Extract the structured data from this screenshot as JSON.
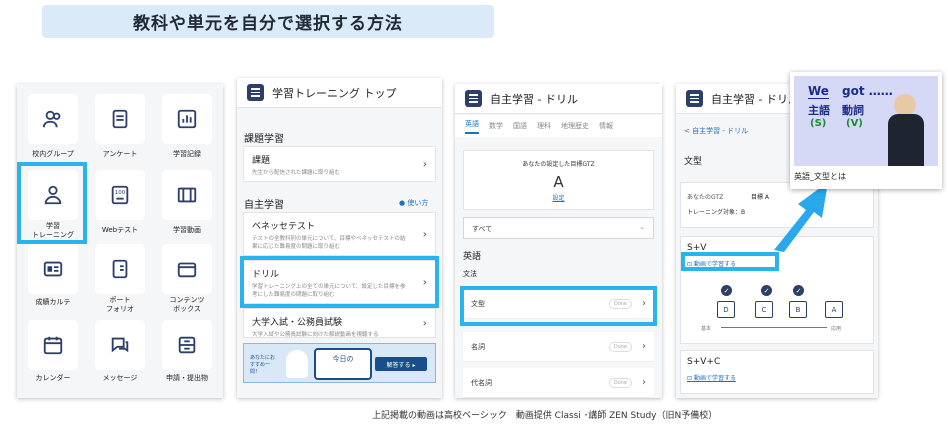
{
  "banner": {
    "title": "教科や単元を自分で選択する方法"
  },
  "menu": {
    "items": [
      {
        "label": "校内グループ"
      },
      {
        "label": "アンケート"
      },
      {
        "label": "学習記録"
      },
      {
        "label": "学習\nトレーニング"
      },
      {
        "label": "Webテスト"
      },
      {
        "label": "学習動画"
      },
      {
        "label": "成績カルテ"
      },
      {
        "label": "ポート\nフォリオ"
      },
      {
        "label": "コンテンツ\nボックス"
      },
      {
        "label": "カレンダー"
      },
      {
        "label": "メッセージ"
      },
      {
        "label": "申請・提出物"
      }
    ]
  },
  "training": {
    "header": "学習トレーニング トップ",
    "assigned_section": "課題学習",
    "assigned_card": {
      "title": "課題",
      "desc": "先生から配信された課題に取り組む"
    },
    "self_section": "自主学習",
    "howto": "使い方",
    "cards": [
      {
        "title": "ベネッセテスト",
        "desc": "テストの全教科別の単元について、目標やベネッセテストの結果に応じた難易度の問題に取り組む"
      },
      {
        "title": "ドリル",
        "desc": "学習トレーニング上の全ての単元について、設定した目標を参考にした難易度の問題に取り組む"
      },
      {
        "title": "大学入試・公務員試験",
        "desc": "大学入試や公務員試験に向けた解説動画を視聴する"
      }
    ],
    "ad": {
      "small": "あなたにおすすめ一問！",
      "today": "今日の",
      "button": "解答する ▸"
    }
  },
  "drill": {
    "header": "自主学習 - ドリル",
    "tabs": [
      "英語",
      "数学",
      "国語",
      "理科",
      "地理歴史",
      "情報"
    ],
    "gtz_label": "あなたの設定した目標GTZ",
    "gtz_value": "A",
    "gtz_link": "設定",
    "filter": "すべて",
    "subject": "英語",
    "category": "文法",
    "units": [
      {
        "name": "文型",
        "pill": "Done"
      },
      {
        "name": "名詞",
        "pill": "Done"
      },
      {
        "name": "代名詞",
        "pill": "Done"
      }
    ]
  },
  "unit": {
    "header": "自主学習 - ドリル",
    "breadcrumb": "< 自主学習 - ドリル",
    "title": "文型",
    "gtz_line": "あなたのGTZ",
    "gtz_target": "目標 A",
    "target_line": "トレーニング対象：B",
    "pattern1": "S+V",
    "video_link1": "動画で学習する",
    "levels": [
      "D",
      "C",
      "B",
      "A"
    ],
    "scale_left": "基本",
    "scale_right": "応用",
    "pattern2": "S+V+C",
    "video_link2": "動画で学習する"
  },
  "video": {
    "line1_a": "We",
    "line1_b": "got ……",
    "line2_a": "主語",
    "line2_b": "動詞",
    "line3_a": "(S)",
    "line3_b": "(V)",
    "caption": "英語_文型とは"
  },
  "footer": {
    "text": "上記掲載の動画は高校ベーシック　動画提供 Classi ･講師 ZEN Study（旧N予備校）"
  }
}
